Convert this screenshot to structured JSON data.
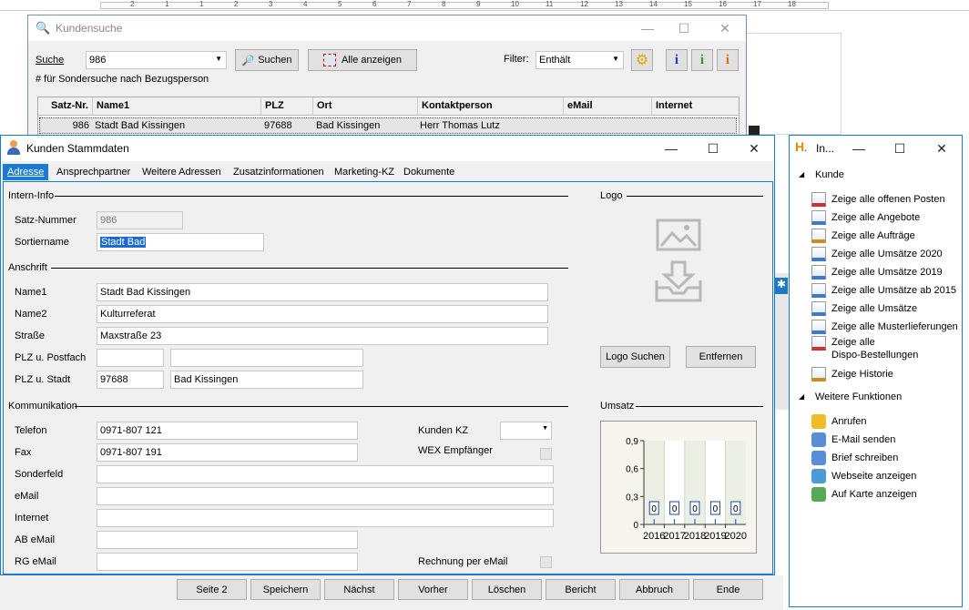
{
  "ruler": {
    "marks": [
      "2",
      "1",
      "1",
      "2",
      "3",
      "4",
      "5",
      "6",
      "7",
      "8",
      "9",
      "10",
      "11",
      "12",
      "13",
      "14",
      "15",
      "16",
      "17",
      "18"
    ]
  },
  "search": {
    "title": "Kundensuche",
    "search_label": "Suche",
    "search_value": "986",
    "search_button": "Suchen",
    "show_all_button": "Alle anzeigen",
    "filter_label": "Filter:",
    "filter_value": "Enthält",
    "hint": "# für Sondersuche nach Bezugsperson",
    "columns": [
      "Satz-Nr.",
      "Name1",
      "PLZ",
      "Ort",
      "Kontaktperson",
      "eMail",
      "Internet"
    ],
    "rows": [
      [
        "986",
        "Stadt Bad Kissingen",
        "97688",
        "Bad Kissingen",
        "Herr Thomas Lutz",
        "",
        ""
      ]
    ]
  },
  "stamm": {
    "title": "Kunden Stammdaten",
    "tabs": [
      "Adresse",
      "Ansprechpartner",
      "Weitere Adressen",
      "Zusatzinformationen",
      "Marketing-KZ",
      "Dokumente"
    ],
    "groups": {
      "intern": "Intern-Info",
      "anschrift": "Anschrift",
      "kommunikation": "Kommunikation",
      "logo": "Logo",
      "umsatz": "Umsatz"
    },
    "labels": {
      "satz": "Satz-Nummer",
      "sortier": "Sortiername",
      "name1": "Name1",
      "name2": "Name2",
      "strasse": "Straße",
      "plz_postfach": "PLZ u. Postfach",
      "plz_stadt": "PLZ u. Stadt",
      "telefon": "Telefon",
      "fax": "Fax",
      "sonderfeld": "Sonderfeld",
      "email": "eMail",
      "internet": "Internet",
      "ab_email": "AB eMail",
      "rg_email": "RG eMail",
      "kunden_kz": "Kunden KZ",
      "wex": "WEX Empfänger",
      "rechnung": "Rechnung per eMail"
    },
    "values": {
      "satz": "986",
      "sortier": "Stadt Bad",
      "name1": "Stadt Bad Kissingen",
      "name2": "Kulturreferat",
      "strasse": "Maxstraße 23",
      "plz_postfach": "",
      "postfach": "",
      "plz": "97688",
      "stadt": "Bad Kissingen",
      "telefon": "0971-807 121",
      "fax": "0971-807 191",
      "sonderfeld": "",
      "email": "",
      "internet": "",
      "ab_email": "",
      "rg_email": "",
      "kunden_kz": ""
    },
    "logo_search": "Logo Suchen",
    "logo_remove": "Entfernen",
    "buttons": [
      "Seite 2",
      "Speichern",
      "Nächst",
      "Vorher",
      "Löschen",
      "Bericht",
      "Abbruch",
      "Ende"
    ]
  },
  "info": {
    "title": "In...",
    "section1": "Kunde",
    "items1": [
      "Zeige alle offenen Posten",
      "Zeige alle Angebote",
      "Zeige alle Aufträge",
      "Zeige alle Umsätze 2020",
      "Zeige alle Umsätze 2019",
      "Zeige alle Umsätze ab 2015",
      "Zeige alle Umsätze",
      "Zeige alle Musterlieferungen",
      "Zeige alle\nDispo-Bestellungen",
      "Zeige Historie"
    ],
    "section2": "Weitere Funktionen",
    "items2": [
      "Anrufen",
      "E-Mail senden",
      "Brief schreiben",
      "Webseite anzeigen",
      "Auf Karte anzeigen"
    ]
  },
  "chart_data": {
    "type": "bar",
    "title": "Umsatz",
    "categories": [
      "2016",
      "2017",
      "2018",
      "2019",
      "2020"
    ],
    "values": [
      0,
      0,
      0,
      0,
      0
    ],
    "ylim": [
      0,
      0.9
    ],
    "yticks": [
      "0",
      "0,3",
      "0,6",
      "0,9"
    ],
    "data_labels": [
      "0",
      "0",
      "0",
      "0",
      "0"
    ]
  }
}
